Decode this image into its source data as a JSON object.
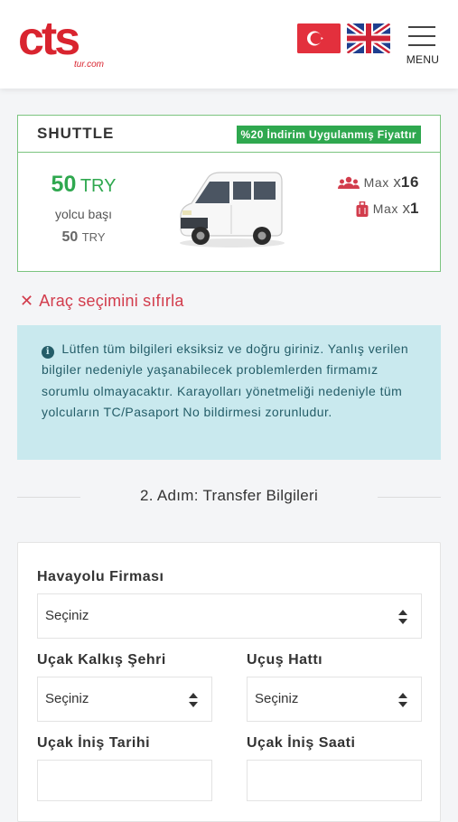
{
  "header": {
    "logo_text": "cts",
    "logo_subtext": "tur.com",
    "menu_label": "MENU",
    "flags": [
      "turkish-flag",
      "uk-flag"
    ]
  },
  "shuttle": {
    "title": "SHUTTLE",
    "discount_badge": "%20 İndirim Uygulanmış Fiyattır",
    "price": "50",
    "currency": "TRY",
    "per_person": "yolcu başı",
    "sub_price": "50",
    "sub_currency": "TRY",
    "max_label": "Max",
    "passengers_x": "x",
    "passengers_count": "16",
    "luggage_x": "x",
    "luggage_count": "1"
  },
  "reset_link": "Araç seçimini sıfırla",
  "info_text": "Lütfen tüm bilgileri eksiksiz ve doğru giriniz. Yanlış verilen bilgiler nedeniyle yaşanabilecek problemlerden firmamız sorumlu olmayacaktır. Karayolları yönetmeliği nedeniyle tüm yolcuların TC/Pasaport No bildirmesi zorunludur.",
  "step_title": "2. Adım: Transfer Bilgileri",
  "form": {
    "airline_label": "Havayolu Firması",
    "airline_value": "Seçiniz",
    "departure_city_label": "Uçak Kalkış Şehri",
    "departure_city_value": "Seçiniz",
    "flight_line_label": "Uçuş Hattı",
    "flight_line_value": "Seçiniz",
    "landing_date_label": "Uçak İniş Tarihi",
    "landing_time_label": "Uçak İniş Saati"
  },
  "colors": {
    "brand_red": "#d9242f",
    "green": "#2fa84f",
    "info_bg": "#c9e9ee",
    "reset_red": "#d23c4c"
  }
}
